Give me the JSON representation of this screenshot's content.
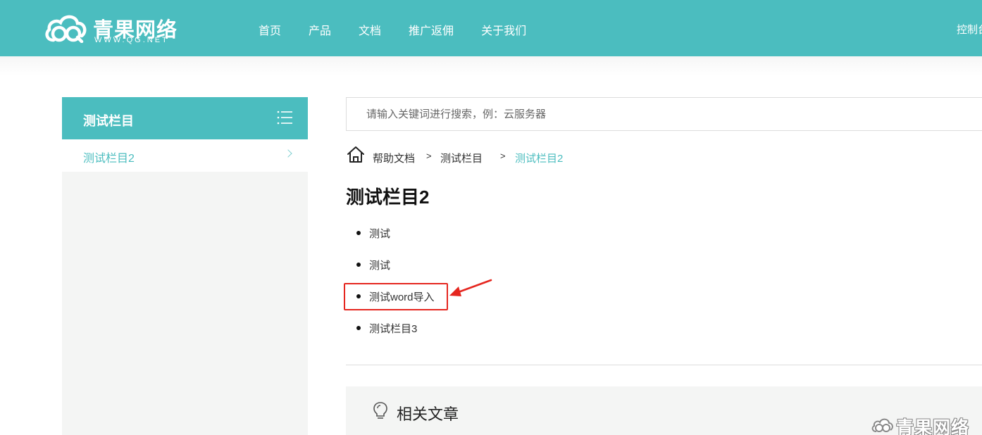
{
  "header": {
    "logo_cn": "青果网络",
    "logo_en": "WWW.QG.NET",
    "nav": [
      "首页",
      "产品",
      "文档",
      "推广返佣",
      "关于我们"
    ],
    "console": "控制台"
  },
  "sidebar": {
    "title": "测试栏目",
    "items": [
      {
        "label": "测试栏目2"
      }
    ]
  },
  "search": {
    "placeholder": "请输入关键词进行搜索，例：云服务器"
  },
  "breadcrumb": {
    "items": [
      "帮助文档",
      "测试栏目",
      "测试栏目2"
    ],
    "separator": ">"
  },
  "main": {
    "title": "测试栏目2",
    "articles": [
      "测试",
      "测试",
      "测试word导入",
      "测试栏目3"
    ],
    "highlighted_index": 2
  },
  "related": {
    "title": "相关文章"
  },
  "watermark": {
    "text": "青果网络"
  },
  "colors": {
    "brand": "#4bbdbf",
    "annotation": "#e5261f"
  }
}
